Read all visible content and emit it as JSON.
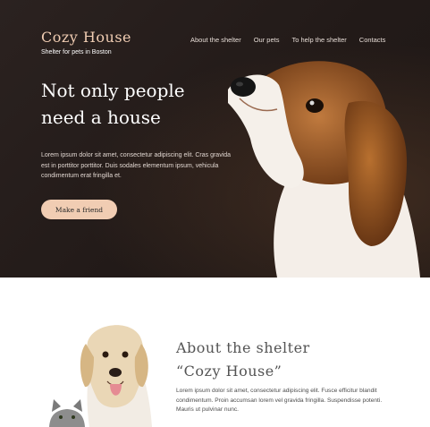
{
  "brand": {
    "title": "Cozy House",
    "subtitle": "Shelter for pets in Boston",
    "accent_color": "#f1cdb3"
  },
  "nav": {
    "items": [
      {
        "label": "About the shelter"
      },
      {
        "label": "Our pets"
      },
      {
        "label": "To help the shelter"
      },
      {
        "label": "Contacts"
      }
    ]
  },
  "hero": {
    "headline_line1": "Not only people",
    "headline_line2": "need a house",
    "text": "Lorem ipsum dolor sit amet, consectetur adipiscing elit. Cras gravida est in porttitor porttitor. Duis sodales elementum ipsum, vehicula condimentum erat fringilla et.",
    "cta_label": "Make a friend",
    "background_color": "#211a18",
    "image": "puppy-photo"
  },
  "about": {
    "title_line1": "About the shelter",
    "title_line2": "“Cozy House”",
    "text": "Lorem ipsum dolor sit amet, consectetur adipiscing elit. Fusce efficitur blandit condimentum. Proin accumsan lorem vel gravida fringilla. Suspendisse potenti. Mauris ut pulvinar nunc.",
    "image": "dog-and-cat-photo"
  }
}
